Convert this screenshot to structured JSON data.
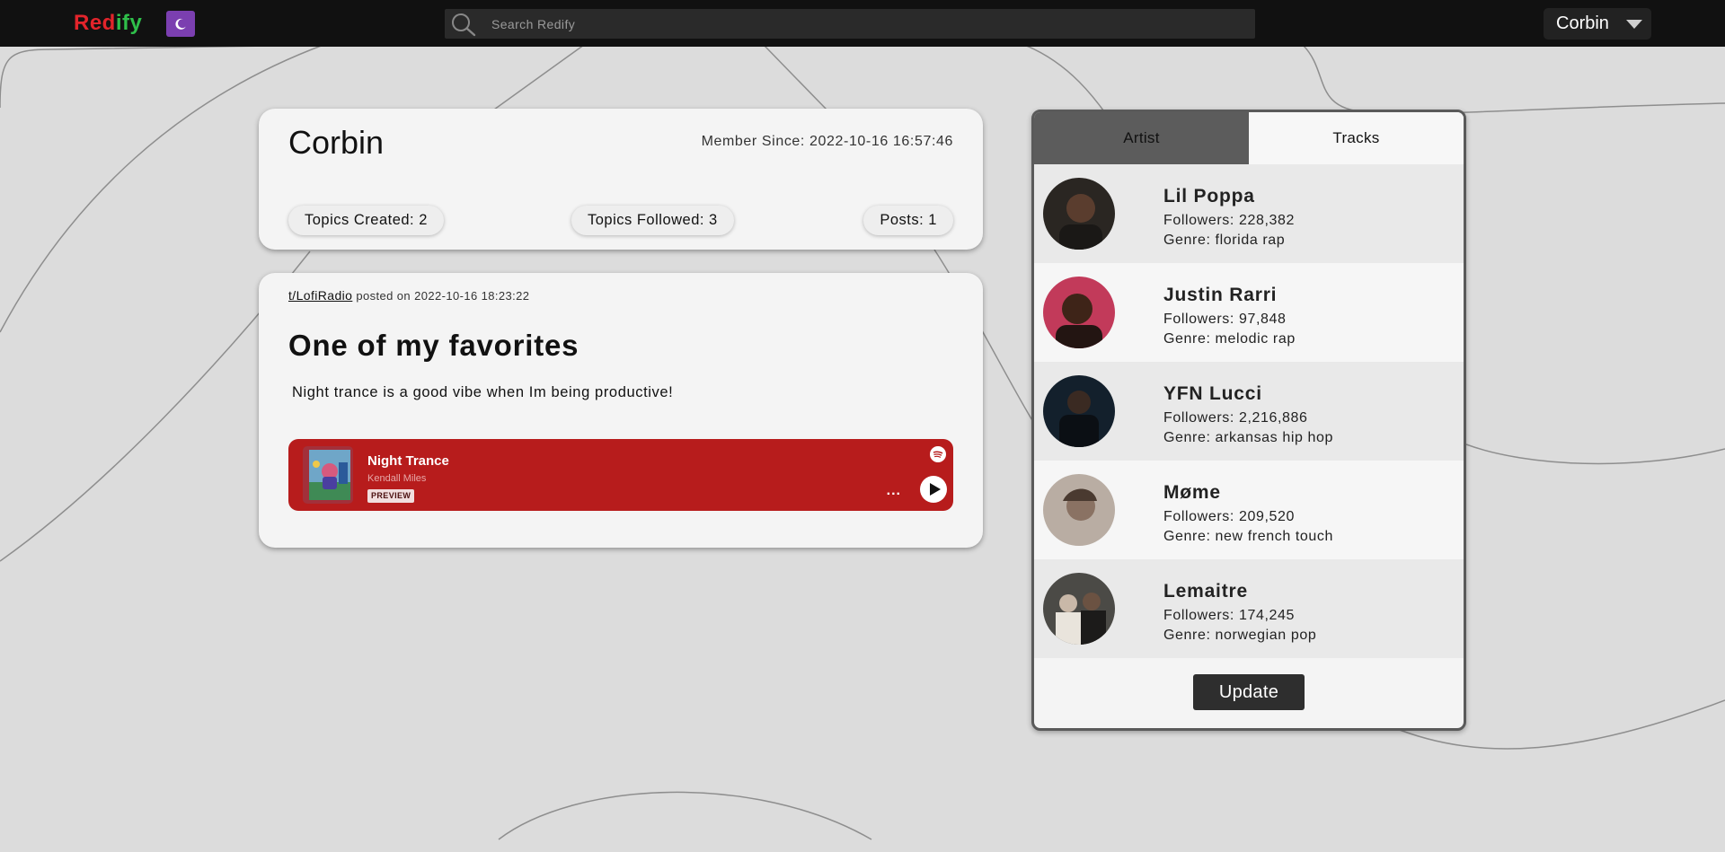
{
  "header": {
    "logo_part1": "Red",
    "logo_part2": "ify",
    "search_placeholder": "Search Redify",
    "user_label": "Corbin"
  },
  "profile": {
    "name": "Corbin",
    "member_since": "Member Since: 2022-10-16 16:57:46",
    "stats": {
      "topics_created": "Topics Created: 2",
      "topics_followed": "Topics Followed: 3",
      "posts": "Posts: 1"
    }
  },
  "post": {
    "topic": "t/LofiRadio",
    "posted_on": "posted on 2022-10-16 18:23:22",
    "title": "One of my favorites",
    "body": "Night trance is a good vibe when Im being productive!",
    "embed": {
      "track": "Night Trance",
      "artist": "Kendall Miles",
      "badge": "PREVIEW",
      "more": "...",
      "background": "#b71c1c"
    }
  },
  "panel": {
    "tabs": [
      "Artist",
      "Tracks"
    ],
    "artists": [
      {
        "name": "Lil Poppa",
        "followers": "Followers: 228,382",
        "genre": "Genre: florida rap"
      },
      {
        "name": "Justin Rarri",
        "followers": "Followers: 97,848",
        "genre": "Genre: melodic rap"
      },
      {
        "name": "YFN Lucci",
        "followers": "Followers: 2,216,886",
        "genre": "Genre: arkansas hip hop"
      },
      {
        "name": "Møme",
        "followers": "Followers: 209,520",
        "genre": "Genre: new french touch"
      },
      {
        "name": "Lemaitre",
        "followers": "Followers: 174,245",
        "genre": "Genre: norwegian pop"
      }
    ],
    "update_label": "Update"
  },
  "colors": {
    "accent_purple": "#7b3fb0",
    "logo_red": "#e3242b",
    "logo_green": "#2fbf4a",
    "topbar": "#111111"
  }
}
